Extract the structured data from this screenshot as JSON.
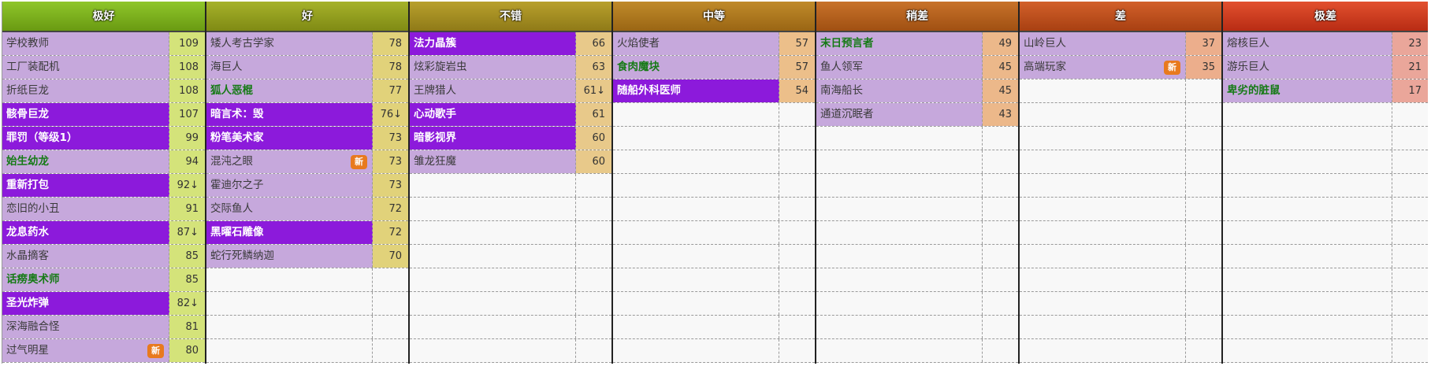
{
  "tiers": [
    {
      "label": "极好",
      "header_colors": [
        "#8fc62a",
        "#6a9a12"
      ],
      "score_bg": "#d4e37a",
      "rows": [
        {
          "name": "学校教师",
          "score": "109",
          "style": "normal"
        },
        {
          "name": "工厂装配机",
          "score": "108",
          "style": "normal"
        },
        {
          "name": "折纸巨龙",
          "score": "108",
          "style": "normal"
        },
        {
          "name": "骸骨巨龙",
          "score": "107",
          "style": "purple"
        },
        {
          "name": "罪罚（等级1）",
          "score": "99",
          "style": "purple"
        },
        {
          "name": "始生幼龙",
          "score": "94",
          "style": "green"
        },
        {
          "name": "重新打包",
          "score": "92↓",
          "style": "purple"
        },
        {
          "name": "恋旧的小丑",
          "score": "91",
          "style": "normal"
        },
        {
          "name": "龙息药水",
          "score": "87↓",
          "style": "purple"
        },
        {
          "name": "水晶摘客",
          "score": "85",
          "style": "normal"
        },
        {
          "name": "话痨奥术师",
          "score": "85",
          "style": "green"
        },
        {
          "name": "圣光炸弹",
          "score": "82↓",
          "style": "purple"
        },
        {
          "name": "深海融合怪",
          "score": "81",
          "style": "normal"
        },
        {
          "name": "过气明星",
          "score": "80",
          "style": "normal",
          "badge": "新"
        }
      ]
    },
    {
      "label": "好",
      "header_colors": [
        "#a6b22a",
        "#7f8a14"
      ],
      "score_bg": "#e1d27a",
      "rows": [
        {
          "name": "矮人考古学家",
          "score": "78",
          "style": "normal"
        },
        {
          "name": "海巨人",
          "score": "78",
          "style": "normal"
        },
        {
          "name": "狐人恶棍",
          "score": "77",
          "style": "green"
        },
        {
          "name": "暗言术：毁",
          "score": "76↓",
          "style": "purple"
        },
        {
          "name": "粉笔美术家",
          "score": "73",
          "style": "purple"
        },
        {
          "name": "混沌之眼",
          "score": "73",
          "style": "normal",
          "badge": "新"
        },
        {
          "name": "霍迪尔之子",
          "score": "73",
          "style": "normal"
        },
        {
          "name": "交际鱼人",
          "score": "72",
          "style": "normal"
        },
        {
          "name": "黑曜石雕像",
          "score": "72",
          "style": "purple"
        },
        {
          "name": "蛇行死鳞纳迦",
          "score": "70",
          "style": "normal"
        }
      ]
    },
    {
      "label": "不错",
      "header_colors": [
        "#b8a02c",
        "#8f7a18"
      ],
      "score_bg": "#e8c98a",
      "rows": [
        {
          "name": "法力晶簇",
          "score": "66",
          "style": "purple"
        },
        {
          "name": "炫彩旋岩虫",
          "score": "63",
          "style": "normal"
        },
        {
          "name": "王牌猎人",
          "score": "61↓",
          "style": "normal"
        },
        {
          "name": "心动歌手",
          "score": "61",
          "style": "purple"
        },
        {
          "name": "暗影视界",
          "score": "60",
          "style": "purple"
        },
        {
          "name": "雏龙狂魔",
          "score": "60",
          "style": "normal"
        }
      ]
    },
    {
      "label": "中等",
      "header_colors": [
        "#c08a2a",
        "#9a6614"
      ],
      "score_bg": "#ecbf8a",
      "rows": [
        {
          "name": "火焰使者",
          "score": "57",
          "style": "normal"
        },
        {
          "name": "食肉魔块",
          "score": "57",
          "style": "green"
        },
        {
          "name": "随船外科医师",
          "score": "54",
          "style": "purple"
        }
      ]
    },
    {
      "label": "稍差",
      "header_colors": [
        "#c8722a",
        "#a05012"
      ],
      "score_bg": "#ecb88a",
      "rows": [
        {
          "name": "末日预言者",
          "score": "49",
          "style": "green"
        },
        {
          "name": "鱼人领军",
          "score": "45",
          "style": "normal"
        },
        {
          "name": "南海船长",
          "score": "45",
          "style": "normal"
        },
        {
          "name": "通道沉眠者",
          "score": "43",
          "style": "normal"
        }
      ]
    },
    {
      "label": "差",
      "header_colors": [
        "#d2602a",
        "#a84012"
      ],
      "score_bg": "#ecae8c",
      "rows": [
        {
          "name": "山岭巨人",
          "score": "37",
          "style": "normal"
        },
        {
          "name": "高端玩家",
          "score": "35",
          "style": "normal",
          "badge": "新"
        }
      ]
    },
    {
      "label": "极差",
      "header_colors": [
        "#e2502e",
        "#b82c14"
      ],
      "score_bg": "#eaa69a",
      "rows": [
        {
          "name": "熔核巨人",
          "score": "23",
          "style": "normal"
        },
        {
          "name": "游乐巨人",
          "score": "21",
          "style": "normal"
        },
        {
          "name": "卑劣的脏鼠",
          "score": "17",
          "style": "green"
        }
      ]
    }
  ]
}
